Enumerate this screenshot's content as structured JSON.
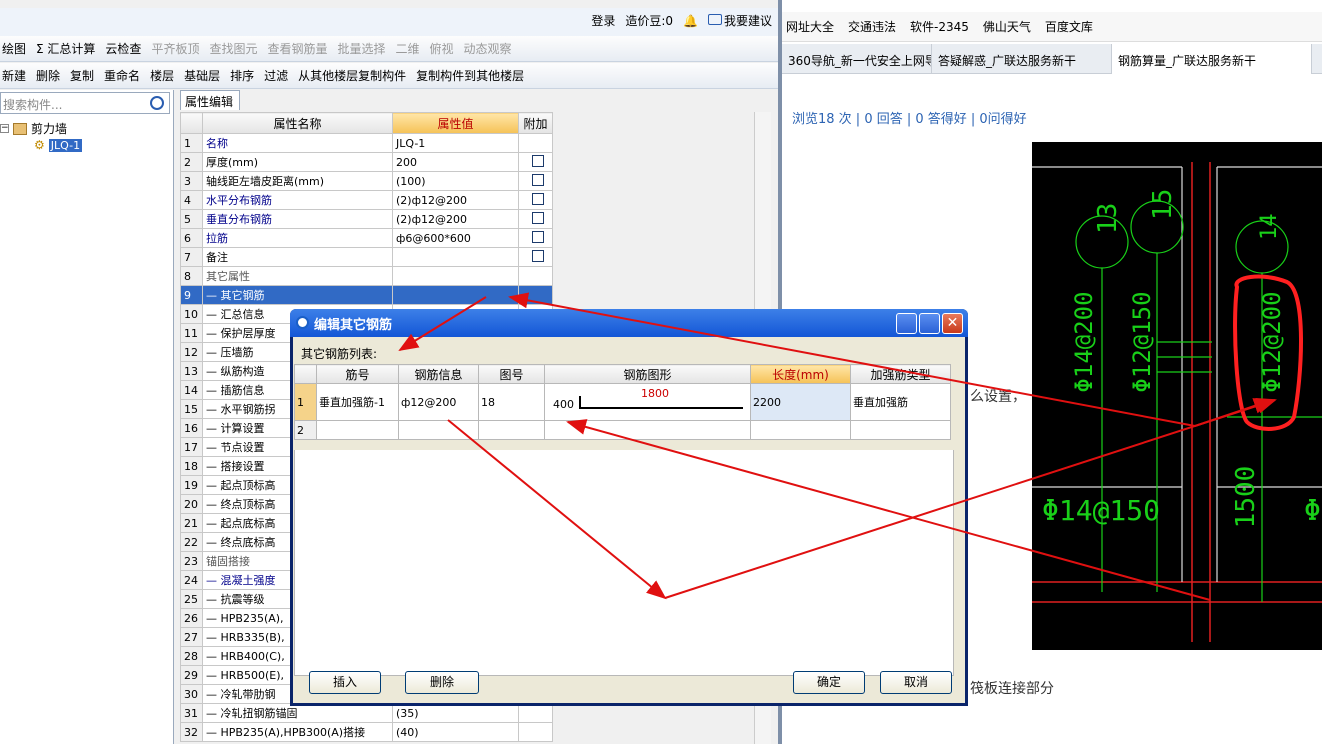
{
  "left_app": {
    "top_bar": {
      "login": "登录",
      "coins": "造价豆:0",
      "suggest": "我要建议"
    },
    "toolbar1": [
      {
        "label": "绘图",
        "disabled": false
      },
      {
        "label": "Σ 汇总计算",
        "disabled": false
      },
      {
        "label": "云检查",
        "disabled": false
      },
      {
        "label": "平齐板顶",
        "disabled": true
      },
      {
        "label": "查找图元",
        "disabled": true
      },
      {
        "label": "查看钢筋量",
        "disabled": true
      },
      {
        "label": "批量选择",
        "disabled": true
      },
      {
        "label": "二维",
        "disabled": true
      },
      {
        "label": "俯视",
        "disabled": true
      },
      {
        "label": "动态观察",
        "disabled": true
      }
    ],
    "toolbar2": [
      {
        "label": "新建"
      },
      {
        "label": "删除"
      },
      {
        "label": "复制"
      },
      {
        "label": "重命名"
      },
      {
        "label": "楼层"
      },
      {
        "label": "基础层"
      },
      {
        "label": "排序"
      },
      {
        "label": "过滤"
      },
      {
        "label": "从其他楼层复制构件"
      },
      {
        "label": "复制构件到其他楼层"
      }
    ],
    "search_placeholder": "搜索构件...",
    "tree": {
      "root": "剪力墙",
      "child": "JLQ-1"
    },
    "prop_tab": "属性编辑",
    "prop_headers": {
      "name": "属性名称",
      "value": "属性值",
      "extra": "附加"
    },
    "props": [
      {
        "n": "1",
        "name": "名称",
        "value": "JLQ-1",
        "blue": true,
        "chk": false,
        "grp": false,
        "sel": false
      },
      {
        "n": "2",
        "name": "厚度(mm)",
        "value": "200",
        "blue": false,
        "chk": true,
        "grp": false,
        "sel": false
      },
      {
        "n": "3",
        "name": "轴线距左墙皮距离(mm)",
        "value": "(100)",
        "blue": false,
        "chk": true,
        "grp": false,
        "sel": false
      },
      {
        "n": "4",
        "name": "水平分布钢筋",
        "value": "(2)ф12@200",
        "blue": true,
        "chk": true,
        "grp": false,
        "sel": false
      },
      {
        "n": "5",
        "name": "垂直分布钢筋",
        "value": "(2)ф12@200",
        "blue": true,
        "chk": true,
        "grp": false,
        "sel": false
      },
      {
        "n": "6",
        "name": "拉筋",
        "value": "ф6@600*600",
        "blue": true,
        "chk": true,
        "grp": false,
        "sel": false
      },
      {
        "n": "7",
        "name": "备注",
        "value": "",
        "blue": false,
        "chk": true,
        "grp": false,
        "sel": false
      },
      {
        "n": "8",
        "name": "其它属性",
        "value": "",
        "blue": false,
        "chk": false,
        "grp": true,
        "sel": false
      },
      {
        "n": "9",
        "name": "— 其它钢筋",
        "value": "",
        "blue": false,
        "chk": false,
        "grp": false,
        "sel": true
      },
      {
        "n": "10",
        "name": "— 汇总信息",
        "value": "",
        "blue": false,
        "chk": false,
        "grp": false,
        "sel": false
      },
      {
        "n": "11",
        "name": "— 保护层厚度",
        "value": "",
        "blue": false,
        "chk": false,
        "grp": false,
        "sel": false
      },
      {
        "n": "12",
        "name": "— 压墙筋",
        "value": "",
        "blue": false,
        "chk": false,
        "grp": false,
        "sel": false
      },
      {
        "n": "13",
        "name": "— 纵筋构造",
        "value": "",
        "blue": false,
        "chk": false,
        "grp": false,
        "sel": false
      },
      {
        "n": "14",
        "name": "— 插筋信息",
        "value": "",
        "blue": false,
        "chk": false,
        "grp": false,
        "sel": false
      },
      {
        "n": "15",
        "name": "— 水平钢筋拐",
        "value": "",
        "blue": false,
        "chk": false,
        "grp": false,
        "sel": false
      },
      {
        "n": "16",
        "name": "— 计算设置",
        "value": "",
        "blue": false,
        "chk": false,
        "grp": false,
        "sel": false
      },
      {
        "n": "17",
        "name": "— 节点设置",
        "value": "",
        "blue": false,
        "chk": false,
        "grp": false,
        "sel": false
      },
      {
        "n": "18",
        "name": "— 搭接设置",
        "value": "",
        "blue": false,
        "chk": false,
        "grp": false,
        "sel": false
      },
      {
        "n": "19",
        "name": "— 起点顶标高",
        "value": "",
        "blue": false,
        "chk": false,
        "grp": false,
        "sel": false
      },
      {
        "n": "20",
        "name": "— 终点顶标高",
        "value": "",
        "blue": false,
        "chk": false,
        "grp": false,
        "sel": false
      },
      {
        "n": "21",
        "name": "— 起点底标高",
        "value": "",
        "blue": false,
        "chk": false,
        "grp": false,
        "sel": false
      },
      {
        "n": "22",
        "name": "— 终点底标高",
        "value": "",
        "blue": false,
        "chk": false,
        "grp": false,
        "sel": false
      },
      {
        "n": "23",
        "name": "锚固搭接",
        "value": "",
        "blue": false,
        "chk": false,
        "grp": true,
        "sel": false
      },
      {
        "n": "24",
        "name": "— 混凝土强度",
        "value": "",
        "blue": true,
        "chk": false,
        "grp": false,
        "sel": false
      },
      {
        "n": "25",
        "name": "— 抗震等级",
        "value": "",
        "blue": false,
        "chk": false,
        "grp": false,
        "sel": false
      },
      {
        "n": "26",
        "name": "— HPB235(A),",
        "value": "",
        "blue": false,
        "chk": false,
        "grp": false,
        "sel": false
      },
      {
        "n": "27",
        "name": "— HRB335(B),",
        "value": "",
        "blue": false,
        "chk": false,
        "grp": false,
        "sel": false
      },
      {
        "n": "28",
        "name": "— HRB400(C),",
        "value": "",
        "blue": false,
        "chk": false,
        "grp": false,
        "sel": false
      },
      {
        "n": "29",
        "name": "— HRB500(E),",
        "value": "",
        "blue": false,
        "chk": false,
        "grp": false,
        "sel": false
      },
      {
        "n": "30",
        "name": "— 冷轧带肋钢",
        "value": "",
        "blue": false,
        "chk": false,
        "grp": false,
        "sel": false
      },
      {
        "n": "31",
        "name": "— 冷轧扭钢筋锚固",
        "value": "(35)",
        "blue": false,
        "chk": false,
        "grp": false,
        "sel": false
      },
      {
        "n": "32",
        "name": "— HPB235(A),HPB300(A)搭接",
        "value": "(40)",
        "blue": false,
        "chk": false,
        "grp": false,
        "sel": false
      }
    ]
  },
  "dialog": {
    "title": "编辑其它钢筋",
    "list_label": "其它钢筋列表:",
    "headers": [
      "筋号",
      "钢筋信息",
      "图号",
      "钢筋图形",
      "长度(mm)",
      "加强筋类型"
    ],
    "rows": [
      {
        "n": "1",
        "name": "垂直加强筋-1",
        "info": "ф12@200",
        "fig_no": "18",
        "dim_left": "400",
        "dim_top": "1800",
        "length": "2200",
        "type": "垂直加强筋"
      },
      {
        "n": "2",
        "name": "",
        "info": "",
        "fig_no": "",
        "dim_left": "",
        "dim_top": "",
        "length": "",
        "type": ""
      }
    ],
    "buttons": {
      "insert": "插入",
      "delete": "删除",
      "ok": "确定",
      "cancel": "取消"
    }
  },
  "browser": {
    "bookmarks": [
      "网址大全",
      "交通违法",
      "软件-2345",
      "佛山天气",
      "百度文库"
    ],
    "tabs": [
      "360导航_新一代安全上网导",
      "答疑解惑_广联达服务新干",
      "钢筋算量_广联达服务新干"
    ],
    "stats": "浏览18 次 | 0 回答 | 0 答得好 | 0问得好",
    "side_text1": "么设置，",
    "side_text2": "筏板连接部分",
    "cad_labels": [
      "13",
      "15",
      "14",
      "Φ14@200",
      "Φ12@150",
      "Φ12@200",
      "Φ14@150",
      "1500",
      "Φ"
    ]
  }
}
